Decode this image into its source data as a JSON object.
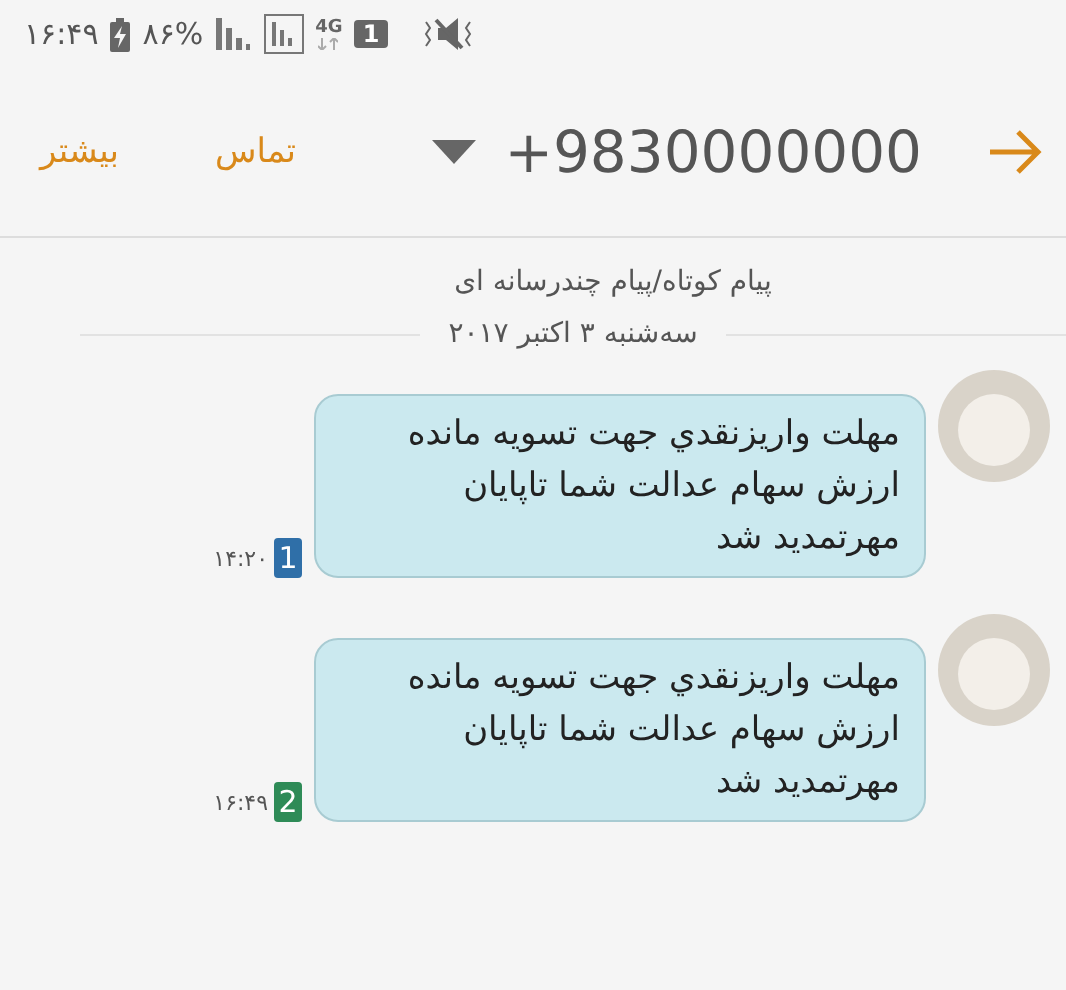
{
  "status_bar": {
    "time": "۱۶:۴۹",
    "battery": "۸۶%",
    "network": "4G",
    "sim": "1"
  },
  "header": {
    "number": "+9830000000",
    "actions": [
      "تماس",
      "بیشتر"
    ]
  },
  "subtitle": "پیام کوتاه/پیام چندرسانه ای",
  "date": "سه‌شنبه ۳ اکتبر ۲۰۱۷",
  "messages": [
    {
      "text": "مهلت واريزنقدي جهت تسويه مانده\nارزش سهام عدالت شما تاپایان\nمهرتمدید شد",
      "time": "۱۴:۲۰",
      "sim": "1",
      "color": "#2f6fa8"
    },
    {
      "text": "مهلت واريزنقدي جهت تسويه مانده\nارزش سهام عدالت شما تاپایان\nمهرتمدید شد",
      "time": "۱۶:۴۹",
      "sim": "2",
      "color": "#2e8b57"
    }
  ]
}
